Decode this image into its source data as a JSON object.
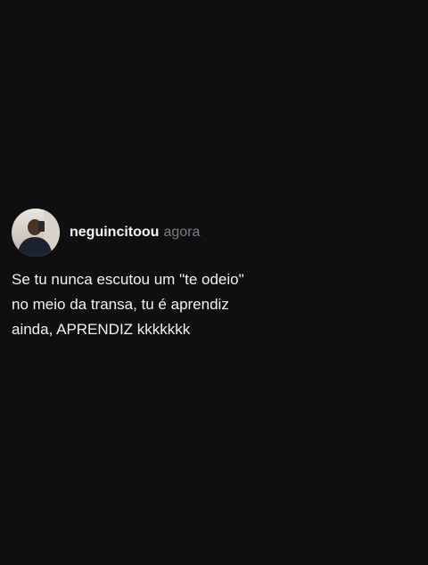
{
  "post": {
    "username": "neguincitoou",
    "timestamp": "agora",
    "text": "Se tu nunca escutou um \"te odeio\"\nno meio da transa, tu é aprendiz\nainda, APRENDIZ kkkkkkk"
  },
  "icons": {
    "avatar": "profile-photo"
  },
  "colors": {
    "background": "#0f0e10",
    "text": "#f2f2f2",
    "muted": "#7b7b80"
  }
}
